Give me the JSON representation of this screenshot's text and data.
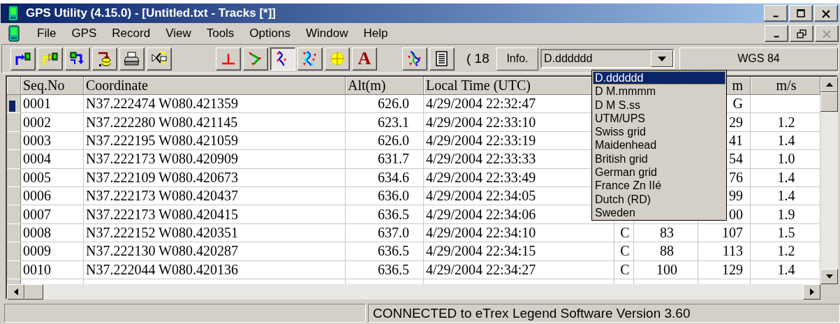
{
  "window": {
    "title": "GPS Utility (4.15.0) - [Untitled.txt - Tracks [*]]"
  },
  "menu": [
    "File",
    "GPS",
    "Record",
    "View",
    "Tools",
    "Options",
    "Window",
    "Help"
  ],
  "toolbar": {
    "buttons": [
      {
        "kind": "upload",
        "pressed": false
      },
      {
        "kind": "upload-yellow",
        "pressed": false
      },
      {
        "kind": "download",
        "pressed": false
      },
      {
        "kind": "save",
        "pressed": false
      },
      {
        "kind": "print",
        "pressed": false
      },
      {
        "kind": "export",
        "pressed": false
      },
      {
        "kind": "gap"
      },
      {
        "kind": "waypoint",
        "pressed": false
      },
      {
        "kind": "route",
        "pressed": false
      },
      {
        "kind": "track",
        "pressed": true
      },
      {
        "kind": "track-multi",
        "pressed": false
      },
      {
        "kind": "target",
        "pressed": false
      },
      {
        "kind": "letter",
        "glyph": "A",
        "pressed": false
      },
      {
        "kind": "gap"
      },
      {
        "kind": "merge",
        "pressed": false
      },
      {
        "kind": "list",
        "pressed": false
      }
    ],
    "count": "( 18",
    "info_button": "Info.",
    "format": "D.dddddd",
    "datum": "WGS 84"
  },
  "format_options": [
    {
      "label": "D.dddddd",
      "selected": true
    },
    {
      "label": "D M.mmmm",
      "selected": false
    },
    {
      "label": "D M S.ss",
      "selected": false
    },
    {
      "label": "UTM/UPS",
      "selected": false
    },
    {
      "label": "Swiss grid",
      "selected": false
    },
    {
      "label": "Maidenhead",
      "selected": false
    },
    {
      "label": "British grid",
      "selected": false
    },
    {
      "label": "German grid",
      "selected": false
    },
    {
      "label": "France Zn IIé",
      "selected": false
    },
    {
      "label": "Dutch (RD)",
      "selected": false
    },
    {
      "label": "Sweden",
      "selected": false
    }
  ],
  "table": {
    "columns": [
      "Seq.No",
      "Coordinate",
      "Alt(m)",
      "Local Time (UTC)",
      "",
      "",
      "m",
      "m/s"
    ],
    "rows": [
      {
        "selected": true,
        "cells": [
          "0001",
          "N37.222474 W080.421359",
          "626.0",
          "4/29/2004 22:32:47",
          null,
          null,
          "G",
          null
        ]
      },
      {
        "selected": false,
        "cells": [
          "0002",
          "N37.222280 W080.421145",
          "623.1",
          "4/29/2004 22:33:10",
          null,
          null,
          "29",
          "1.2"
        ]
      },
      {
        "selected": false,
        "cells": [
          "0003",
          "N37.222195 W080.421059",
          "626.0",
          "4/29/2004 22:33:19",
          null,
          null,
          "41",
          "1.4"
        ]
      },
      {
        "selected": false,
        "cells": [
          "0004",
          "N37.222173 W080.420909",
          "631.7",
          "4/29/2004 22:33:33",
          null,
          null,
          "54",
          "1.0"
        ]
      },
      {
        "selected": false,
        "cells": [
          "0005",
          "N37.222109 W080.420673",
          "634.6",
          "4/29/2004 22:33:49",
          null,
          null,
          "76",
          "1.4"
        ]
      },
      {
        "selected": false,
        "cells": [
          "0006",
          "N37.222173 W080.420437",
          "636.0",
          "4/29/2004 22:34:05",
          null,
          null,
          "99",
          "1.4"
        ]
      },
      {
        "selected": false,
        "cells": [
          "0007",
          "N37.222173 W080.420415",
          "636.5",
          "4/29/2004 22:34:06",
          null,
          null,
          "00",
          "1.9"
        ]
      },
      {
        "selected": false,
        "cells": [
          "0008",
          "N37.222152 W080.420351",
          "637.0",
          "4/29/2004 22:34:10",
          "C",
          "83",
          "107",
          "1.5"
        ]
      },
      {
        "selected": false,
        "cells": [
          "0009",
          "N37.222130 W080.420287",
          "636.5",
          "4/29/2004 22:34:15",
          "C",
          "88",
          "113",
          "1.2"
        ]
      },
      {
        "selected": false,
        "cells": [
          "0010",
          "N37.222044 W080.420136",
          "636.5",
          "4/29/2004 22:34:27",
          "C",
          "100",
          "129",
          "1.4"
        ]
      }
    ]
  },
  "status_bar": "CONNECTED to eTrex Legend Software Version 3.60"
}
